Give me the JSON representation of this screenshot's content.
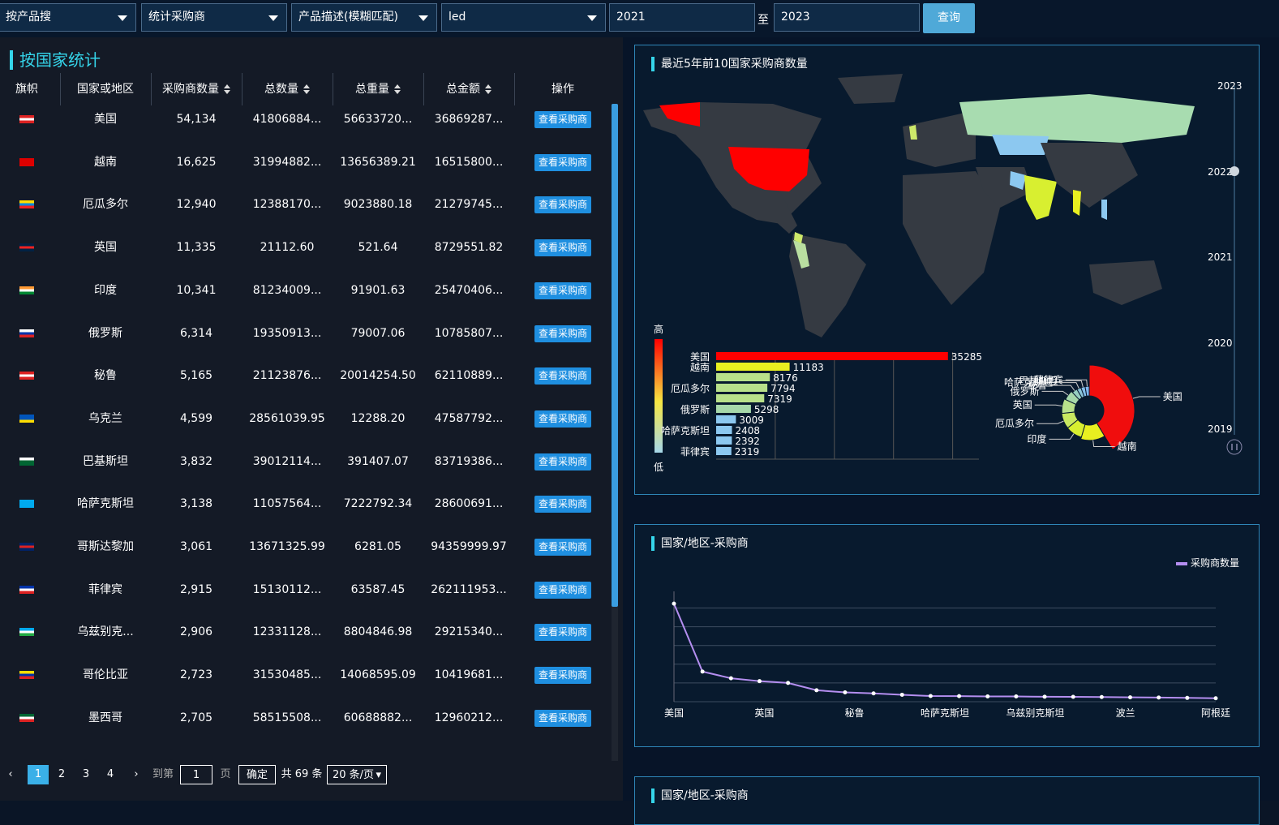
{
  "toolbar": {
    "selects": [
      {
        "value": "按产品搜"
      },
      {
        "value": "统计采购商"
      },
      {
        "value": "产品描述(模糊匹配)"
      },
      {
        "value": "led"
      }
    ],
    "year_from": "2021",
    "year_to": "2023",
    "separator": "至",
    "query_label": "查询"
  },
  "left": {
    "title": "按国家统计",
    "headers": [
      "旗帜",
      "国家或地区",
      "采购商数量",
      "总数量",
      "总重量",
      "总金额",
      "操作"
    ],
    "button_label": "查看采购商",
    "rows": [
      {
        "country": "美国",
        "buyers": "54,134",
        "qty": "41806884...",
        "weight": "56633720...",
        "amount": "36869287...",
        "flag": "us"
      },
      {
        "country": "越南",
        "buyers": "16,625",
        "qty": "31994882...",
        "weight": "13656389.21",
        "amount": "16515800...",
        "flag": "vn"
      },
      {
        "country": "厄瓜多尔",
        "buyers": "12,940",
        "qty": "12388170...",
        "weight": "9023880.18",
        "amount": "21279745...",
        "flag": "ec"
      },
      {
        "country": "英国",
        "buyers": "11,335",
        "qty": "21112.60",
        "weight": "521.64",
        "amount": "8729551.82",
        "flag": "gb"
      },
      {
        "country": "印度",
        "buyers": "10,341",
        "qty": "81234009...",
        "weight": "91901.63",
        "amount": "25470406...",
        "flag": "in"
      },
      {
        "country": "俄罗斯",
        "buyers": "6,314",
        "qty": "19350913...",
        "weight": "79007.06",
        "amount": "10785807...",
        "flag": "ru"
      },
      {
        "country": "秘鲁",
        "buyers": "5,165",
        "qty": "21123876...",
        "weight": "20014254.50",
        "amount": "62110889...",
        "flag": "pe"
      },
      {
        "country": "乌克兰",
        "buyers": "4,599",
        "qty": "28561039.95",
        "weight": "12288.20",
        "amount": "47587792...",
        "flag": "ua"
      },
      {
        "country": "巴基斯坦",
        "buyers": "3,832",
        "qty": "39012114...",
        "weight": "391407.07",
        "amount": "83719386...",
        "flag": "pk"
      },
      {
        "country": "哈萨克斯坦",
        "buyers": "3,138",
        "qty": "11057564...",
        "weight": "7222792.34",
        "amount": "28600691...",
        "flag": "kz"
      },
      {
        "country": "哥斯达黎加",
        "buyers": "3,061",
        "qty": "13671325.99",
        "weight": "6281.05",
        "amount": "94359999.97",
        "flag": "cr"
      },
      {
        "country": "菲律宾",
        "buyers": "2,915",
        "qty": "15130112...",
        "weight": "63587.45",
        "amount": "262111953...",
        "flag": "ph"
      },
      {
        "country": "乌兹别克...",
        "buyers": "2,906",
        "qty": "12331128...",
        "weight": "8804846.98",
        "amount": "29215340...",
        "flag": "uz"
      },
      {
        "country": "哥伦比亚",
        "buyers": "2,723",
        "qty": "31530485...",
        "weight": "14068595.09",
        "amount": "10419681...",
        "flag": "co"
      },
      {
        "country": "墨西哥",
        "buyers": "2,705",
        "qty": "58515508...",
        "weight": "60688882...",
        "amount": "12960212...",
        "flag": "mx"
      }
    ],
    "pager": {
      "pages": [
        "1",
        "2",
        "3",
        "4"
      ],
      "goto_label": "到第",
      "goto_value": "1",
      "page_unit": "页",
      "confirm": "确定",
      "total": "共 69 条",
      "page_size": "20 条/页"
    }
  },
  "map_card": {
    "title": "最近5年前10国家采购商数量",
    "years": [
      "2023",
      "2022",
      "2021",
      "2020",
      "2019"
    ],
    "selected_year": "2022",
    "legend_high": "高",
    "legend_low": "低",
    "colors": {
      "high": "#ff0000",
      "mid": "#f5e642",
      "low": "#a6d8ea",
      "land": "#353a42"
    }
  },
  "chart_data": [
    {
      "type": "bar",
      "orientation": "horizontal",
      "categories": [
        "美国",
        "越南",
        "",
        "厄瓜多尔",
        "",
        "俄罗斯",
        "",
        "哈萨克斯坦",
        "",
        "菲律宾"
      ],
      "values": [
        35285,
        11183,
        8176,
        7794,
        7319,
        5298,
        3009,
        2408,
        2392,
        2319
      ],
      "xlim": [
        0,
        40000
      ]
    },
    {
      "type": "pie",
      "labels": [
        "美国",
        "越南",
        "印度",
        "厄瓜多尔",
        "英国",
        "俄罗斯",
        "秘鲁",
        "哈萨克斯坦",
        "巴基斯坦",
        "菲律宾"
      ],
      "values": [
        35285,
        11183,
        8176,
        7794,
        7319,
        5298,
        3009,
        2408,
        2392,
        2319
      ],
      "colors": [
        "#f00d0d",
        "#e8ef20",
        "#d8ef30",
        "#c8e860",
        "#b8e08a",
        "#a6d8aa",
        "#96cfc0",
        "#8ac6da",
        "#84bde8",
        "#7fb6f0"
      ]
    },
    {
      "type": "line",
      "title": "国家/地区-采购商",
      "series": [
        {
          "name": "采购商数量",
          "values": [
            54134,
            16625,
            12940,
            11335,
            10341,
            6314,
            5165,
            4599,
            3832,
            3138,
            3061,
            2915,
            2906,
            2723,
            2705,
            2583,
            2400,
            2300,
            2100,
            1900
          ]
        }
      ],
      "x_ticks": [
        "美国",
        "英国",
        "秘鲁",
        "哈萨克斯坦",
        "乌兹别克斯坦",
        "波兰",
        "阿根廷"
      ],
      "ylim": [
        0,
        60000
      ]
    }
  ],
  "line_card": {
    "title": "国家/地区-采购商",
    "legend": "采购商数量"
  },
  "third_card": {
    "title": "国家/地区-采购商"
  }
}
